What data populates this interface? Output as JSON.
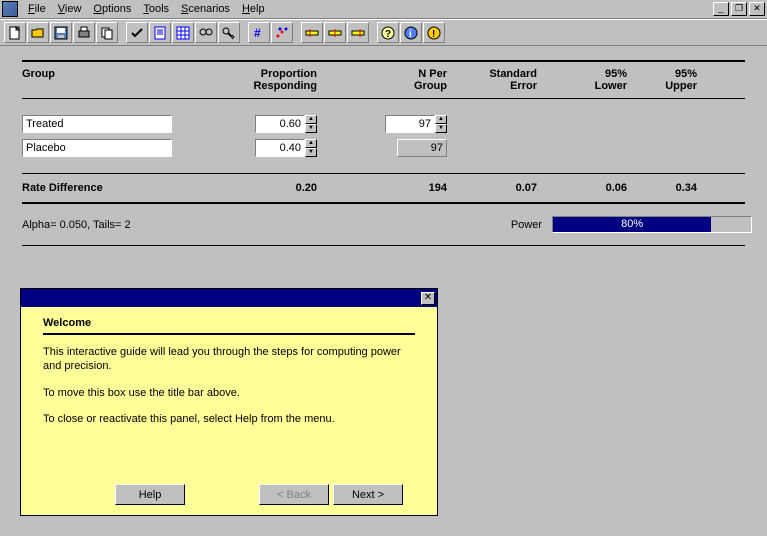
{
  "menu": {
    "items": [
      "File",
      "View",
      "Options",
      "Tools",
      "Scenarios",
      "Help"
    ]
  },
  "winbtns": {
    "min": "_",
    "restore": "❐",
    "close": "✕"
  },
  "toolbar": {
    "icons": [
      "new",
      "open",
      "save",
      "print",
      "copy",
      "",
      "check",
      "page",
      "grid",
      "find",
      "goto",
      "",
      "hash",
      "scatter",
      "",
      "yellow1",
      "yellow2",
      "yellow3",
      "",
      "help",
      "info",
      "alert"
    ]
  },
  "table": {
    "headers": {
      "group": "Group",
      "prop": "Proportion Responding",
      "nper": "N Per Group",
      "stderr": "Standard Error",
      "lower": "95% Lower",
      "upper": "95% Upper"
    },
    "rows": [
      {
        "name": "Treated",
        "prop": "0.60",
        "n": "97"
      },
      {
        "name": "Placebo",
        "prop": "0.40",
        "n": "97"
      }
    ],
    "summary": {
      "label": "Rate Difference",
      "prop": "0.20",
      "n": "194",
      "stderr": "0.07",
      "lower": "0.06",
      "upper": "0.34"
    }
  },
  "footer": {
    "alpha": "Alpha= 0.050, Tails= 2",
    "power_label": "Power",
    "power_value": "80%"
  },
  "welcome": {
    "title": "Welcome",
    "p1": "This interactive guide will lead you through the steps for computing power and precision.",
    "p2": "To move this box use the title bar above.",
    "p3": "To close or reactivate this panel, select Help from the menu.",
    "help": "Help",
    "back": "< Back",
    "next": "Next >"
  }
}
